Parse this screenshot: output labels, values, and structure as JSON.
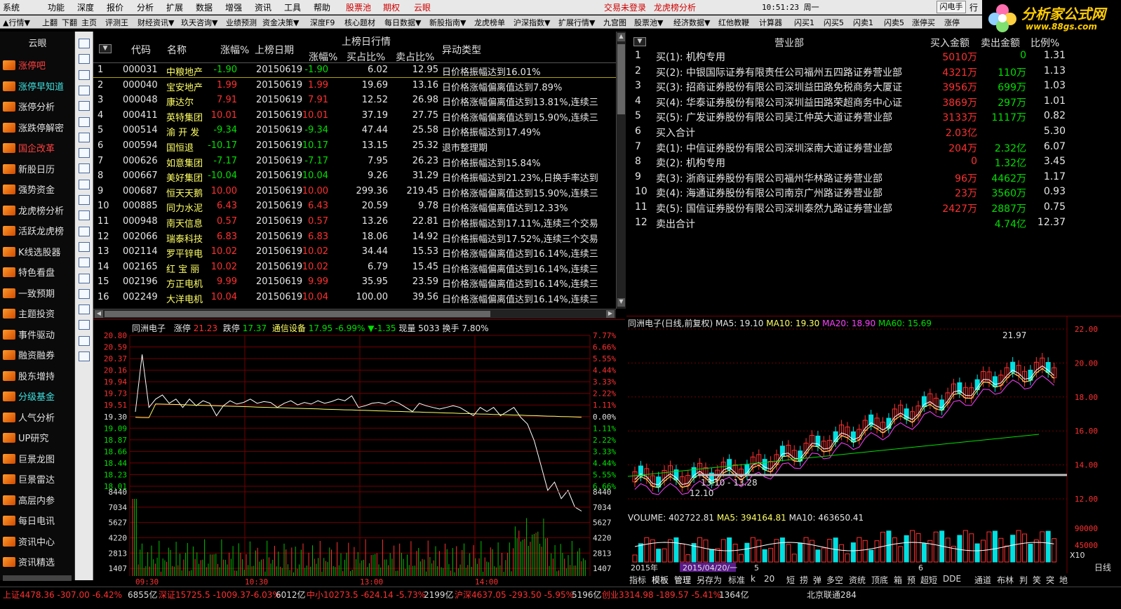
{
  "menubar": {
    "items": [
      "系统",
      "功能",
      "深度",
      "报价",
      "分析",
      "扩展",
      "数据",
      "增强",
      "资讯",
      "工具",
      "帮助"
    ],
    "red_items": [
      "股票池",
      "期权",
      "云眼"
    ],
    "login": "交易未登录",
    "lhb": "龙虎榜分析",
    "clock": "10:51:23 周一",
    "flash": "闪电手",
    "extra": "行"
  },
  "logo": {
    "title": "分析家公式网",
    "url": "www.88gs.com"
  },
  "toolbar": {
    "items": [
      "▲行情▼",
      "上翻",
      "下翻",
      "主页",
      "评测王",
      "财经资讯▼",
      "玖天咨询▼",
      "业绩预测",
      "资金决策▼",
      "深度F9",
      "核心题材",
      "每日数据▼",
      "新股指南▼",
      "龙虎榜单",
      "沪深指数▼",
      "扩展行情▼",
      "九宫图",
      "股票池▼",
      "经济数据▼",
      "红他教鞭",
      "计算器",
      "闪买1",
      "闪买5",
      "闪卖1",
      "闪卖5",
      "涨停买",
      "涨停"
    ]
  },
  "sidebar": {
    "header": "云眼",
    "items": [
      {
        "label": "涨停吧",
        "style": "hl"
      },
      {
        "label": "涨停早知道",
        "style": "cy"
      },
      {
        "label": "涨停分析"
      },
      {
        "label": "涨跌停解密"
      },
      {
        "label": "国企改革",
        "style": "hl"
      },
      {
        "label": "新股日历"
      },
      {
        "label": "强势资金"
      },
      {
        "label": "龙虎榜分析"
      },
      {
        "label": "活跃龙虎榜"
      },
      {
        "label": "K线选股器"
      },
      {
        "label": "特色看盘"
      },
      {
        "label": "一致预期"
      },
      {
        "label": "主题投资"
      },
      {
        "label": "事件驱动"
      },
      {
        "label": "融资融券"
      },
      {
        "label": "股东增持"
      },
      {
        "label": "分级基金",
        "style": "cy"
      },
      {
        "label": "人气分析"
      },
      {
        "label": "UP研究"
      },
      {
        "label": "巨景龙图"
      },
      {
        "label": "巨景雷达"
      },
      {
        "label": "高层内参"
      },
      {
        "label": "每日电讯"
      },
      {
        "label": "资讯中心"
      },
      {
        "label": "资讯精选"
      }
    ]
  },
  "lhb_table": {
    "headers": {
      "code": "代码",
      "name": "名称",
      "chg": "涨幅%",
      "date": "上榜日期",
      "group": "上榜日行情",
      "g_chg": "涨幅%",
      "buy": "买占比%",
      "sell": "卖占比%",
      "type": "异动类型"
    },
    "rows": [
      {
        "no": "1",
        "code": "000031",
        "name": "中粮地产",
        "chg": "-1.90",
        "date": "20150619",
        "g_chg": "-1.90",
        "buy": "6.02",
        "sell": "12.95",
        "type": "日价格振幅达到16.01%"
      },
      {
        "no": "2",
        "code": "000040",
        "name": "宝安地产",
        "chg": "1.99",
        "date": "20150619",
        "g_chg": "1.99",
        "buy": "19.69",
        "sell": "13.16",
        "type": "日价格涨幅偏离值达到7.89%"
      },
      {
        "no": "3",
        "code": "000048",
        "name": "康达尔",
        "chg": "7.91",
        "date": "20150619",
        "g_chg": "7.91",
        "buy": "12.52",
        "sell": "26.98",
        "type": "日价格涨幅偏离值达到13.81%,连续三"
      },
      {
        "no": "4",
        "code": "000411",
        "name": "英特集团",
        "chg": "10.01",
        "date": "20150619",
        "g_chg": "10.01",
        "buy": "37.19",
        "sell": "27.75",
        "type": "日价格涨幅偏离值达到15.90%,连续三"
      },
      {
        "no": "5",
        "code": "000514",
        "name": "渝 开 发",
        "chg": "-9.34",
        "date": "20150619",
        "g_chg": "-9.34",
        "buy": "47.44",
        "sell": "25.58",
        "type": "日价格振幅达到17.49%"
      },
      {
        "no": "6",
        "code": "000594",
        "name": "国恒退",
        "chg": "-10.17",
        "date": "20150619",
        "g_chg": "-10.17",
        "buy": "13.15",
        "sell": "25.32",
        "type": "退市整理期"
      },
      {
        "no": "7",
        "code": "000626",
        "name": "如意集团",
        "chg": "-7.17",
        "date": "20150619",
        "g_chg": "-7.17",
        "buy": "7.95",
        "sell": "26.23",
        "type": "日价格振幅达到15.84%"
      },
      {
        "no": "8",
        "code": "000667",
        "name": "美好集团",
        "chg": "-10.04",
        "date": "20150619",
        "g_chg": "-10.04",
        "buy": "9.26",
        "sell": "31.29",
        "type": "日价格振幅达到21.23%,日换手率达到"
      },
      {
        "no": "9",
        "code": "000687",
        "name": "恒天天鹅",
        "chg": "10.00",
        "date": "20150619",
        "g_chg": "10.00",
        "buy": "299.36",
        "sell": "219.45",
        "type": "日价格涨幅偏离值达到15.90%,连续三"
      },
      {
        "no": "10",
        "code": "000885",
        "name": "同力水泥",
        "chg": "6.43",
        "date": "20150619",
        "g_chg": "6.43",
        "buy": "20.59",
        "sell": "9.78",
        "type": "日价格涨幅偏离值达到12.33%"
      },
      {
        "no": "11",
        "code": "000948",
        "name": "南天信息",
        "chg": "0.57",
        "date": "20150619",
        "g_chg": "0.57",
        "buy": "13.26",
        "sell": "22.81",
        "type": "日价格振幅达到17.11%,连续三个交易"
      },
      {
        "no": "12",
        "code": "002066",
        "name": "瑞泰科技",
        "chg": "6.83",
        "date": "20150619",
        "g_chg": "6.83",
        "buy": "18.06",
        "sell": "14.92",
        "type": "日价格振幅达到17.52%,连续三个交易"
      },
      {
        "no": "13",
        "code": "002114",
        "name": "罗平锌电",
        "chg": "10.02",
        "date": "20150619",
        "g_chg": "10.02",
        "buy": "34.44",
        "sell": "15.53",
        "type": "日价格涨幅偏离值达到16.14%,连续三"
      },
      {
        "no": "14",
        "code": "002165",
        "name": "红 宝 丽",
        "chg": "10.02",
        "date": "20150619",
        "g_chg": "10.02",
        "buy": "6.79",
        "sell": "15.45",
        "type": "日价格涨幅偏离值达到16.14%,连续三"
      },
      {
        "no": "15",
        "code": "002196",
        "name": "方正电机",
        "chg": "9.99",
        "date": "20150619",
        "g_chg": "9.99",
        "buy": "35.95",
        "sell": "23.59",
        "type": "日价格涨幅偏离值达到16.14%,连续三"
      },
      {
        "no": "16",
        "code": "002249",
        "name": "大洋电机",
        "chg": "10.04",
        "date": "20150619",
        "g_chg": "10.04",
        "buy": "100.00",
        "sell": "39.56",
        "type": "日价格涨幅偏离值达到16.14%,连续三"
      }
    ]
  },
  "dept_table": {
    "headers": {
      "dept": "营业部",
      "buy": "买入金额",
      "sell": "卖出金额",
      "ratio": "比例%"
    },
    "rows": [
      {
        "no": "1",
        "name": "买(1): 机构专用",
        "buy": "5010万",
        "sell": "0",
        "ratio": "1.31"
      },
      {
        "no": "2",
        "name": "买(2): 中银国际证券有限责任公司福州五四路证券营业部",
        "buy": "4321万",
        "sell": "110万",
        "ratio": "1.13"
      },
      {
        "no": "3",
        "name": "买(3): 招商证券股份有限公司深圳益田路免税商务大厦证",
        "buy": "3956万",
        "sell": "699万",
        "ratio": "1.03"
      },
      {
        "no": "4",
        "name": "买(4): 华泰证券股份有限公司深圳益田路荣超商务中心证",
        "buy": "3869万",
        "sell": "297万",
        "ratio": "1.01"
      },
      {
        "no": "5",
        "name": "买(5): 广发证券股份有限公司吴江仲英大道证券营业部",
        "buy": "3133万",
        "sell": "1117万",
        "ratio": "0.82"
      },
      {
        "no": "6",
        "name": "买入合计",
        "buy": "2.03亿",
        "sell": "",
        "ratio": "5.30"
      },
      {
        "no": "7",
        "name": "卖(1): 中信证券股份有限公司深圳深南大道证券营业部",
        "buy": "204万",
        "sell": "2.32亿",
        "ratio": "6.07"
      },
      {
        "no": "8",
        "name": "卖(2): 机构专用",
        "buy": "0",
        "sell": "1.32亿",
        "ratio": "3.45"
      },
      {
        "no": "9",
        "name": "卖(3): 浙商证券股份有限公司福州华林路证券营业部",
        "buy": "96万",
        "sell": "4462万",
        "ratio": "1.17"
      },
      {
        "no": "10",
        "name": "卖(4): 海通证券股份有限公司南京广州路证券营业部",
        "buy": "23万",
        "sell": "3560万",
        "ratio": "0.93"
      },
      {
        "no": "11",
        "name": "卖(5): 国信证券股份有限公司深圳泰然九路证券营业部",
        "buy": "2427万",
        "sell": "2887万",
        "ratio": "0.75"
      },
      {
        "no": "12",
        "name": "卖出合计",
        "buy": "",
        "sell": "4.74亿",
        "ratio": "12.37"
      }
    ]
  },
  "intraday": {
    "stock": "同洲电子",
    "limit_up_label": "涨停",
    "limit_up": "21.23",
    "limit_down_label": "跌停",
    "limit_down": "17.37",
    "sector": "通信设备",
    "sector_val": "17.95 -6.99%",
    "sector_chg": "▼-1.35",
    "vol_label": "现量",
    "vol": "5033",
    "turn_label": "换手",
    "turn": "7.80%",
    "price_ticks": [
      "20.80",
      "20.59",
      "20.37",
      "20.16",
      "19.94",
      "19.73",
      "19.51",
      "19.30",
      "19.09",
      "18.87",
      "18.66",
      "18.44",
      "18.23",
      "18.01"
    ],
    "pct_ticks": [
      "7.77%",
      "6.66%",
      "5.55%",
      "4.44%",
      "3.33%",
      "2.22%",
      "1.11%",
      "0.00%",
      "1.11%",
      "2.22%",
      "3.33%",
      "4.44%",
      "5.55%",
      "6.66%"
    ],
    "vol_ticks": [
      "8440",
      "7034",
      "5627",
      "4220",
      "2813",
      "1407"
    ],
    "time_ticks": [
      "09:30",
      "10:30",
      "13:00",
      "14:00"
    ]
  },
  "kline": {
    "title": "同洲电子(日线,前复权)",
    "ma5": "MA5: 19.10",
    "ma10": "MA10: 19.30",
    "ma20": "MA20: 18.90",
    "ma60": "MA60: 15.69",
    "price_ticks": [
      "22.00",
      "20.00",
      "18.00",
      "16.00",
      "14.00",
      "12.00"
    ],
    "high_label": "21.97",
    "range_label": "13.10 - 13.28",
    "low_label": "12.10",
    "vol_title": "VOLUME: 402722.81",
    "vol_ma5": "MA5: 394164.81",
    "vol_ma10": "MA10: 463650.41",
    "vol_ticks": [
      "90000",
      "45000"
    ],
    "vol_unit": "X10",
    "date_labels": [
      "2015年",
      "2015/04/20/一",
      "5",
      "6"
    ]
  },
  "kline_tabs": [
    "指标",
    "模板",
    "管理",
    "另存为",
    "标准",
    "k",
    "20",
    "短",
    "捞",
    "弹",
    "多空",
    "资统",
    "顶底",
    "箱",
    "预",
    "超短",
    "DDE",
    "通道",
    "布林",
    "判",
    "笑",
    "突",
    "地"
  ],
  "right_label": "日线",
  "status": {
    "sh": "上证4478.36 -307.00 -6.42%",
    "sh_amt": "6855亿",
    "sz": "深证15725.5 -1009.37-6.03%",
    "sz_amt": "6012亿",
    "zx": "中小10273.5 -624.14 -5.73%",
    "zx_amt": "2199亿",
    "hs": "沪深4637.05 -293.50 -5.95%",
    "hs_amt": "5196亿",
    "cy": "创业3314.98 -189.57 -5.41%",
    "cy_amt": "1364亿",
    "net": "北京联通284"
  },
  "colors": {
    "up": "#ff3030",
    "down": "#00e000",
    "bg": "#000000",
    "grid": "#700000"
  }
}
